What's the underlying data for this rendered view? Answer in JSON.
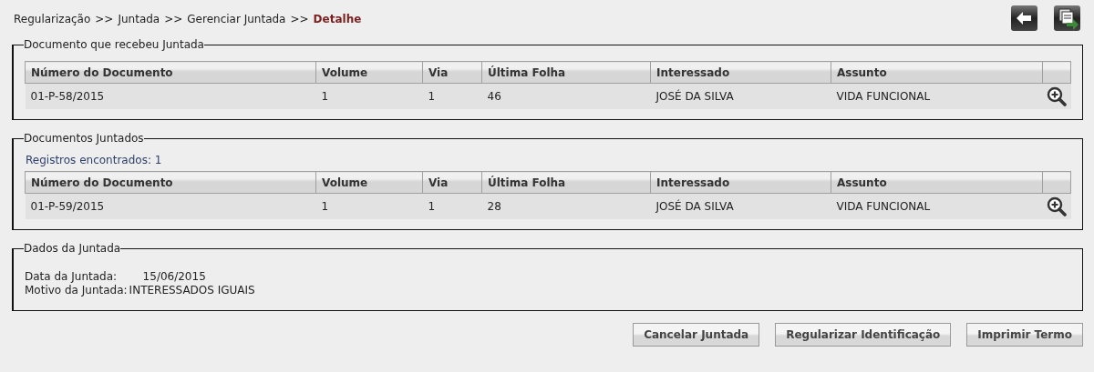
{
  "breadcrumb": [
    {
      "label": "Regularização",
      "kind": "link"
    },
    {
      "label": ">>",
      "kind": "separator"
    },
    {
      "label": "Juntada",
      "kind": "link"
    },
    {
      "label": ">>",
      "kind": "separator"
    },
    {
      "label": "Gerenciar Juntada",
      "kind": "link"
    },
    {
      "label": ">>",
      "kind": "separator"
    },
    {
      "label": "Detalhe",
      "kind": "current"
    }
  ],
  "panels": [
    {
      "kind": "table",
      "legend": "Documento que recebeu Juntada",
      "table": {
        "columns": [
          "Número do Documento",
          "Volume",
          "Via",
          "Última Folha",
          "Interessado",
          "Assunto"
        ],
        "rows": [
          {
            "cells": [
              "01-P-58/2015",
              "1",
              "1",
              "46",
              "JOSÉ DA SILVA",
              "VIDA FUNCIONAL"
            ]
          }
        ]
      }
    },
    {
      "kind": "table",
      "legend": "Documentos Juntados",
      "count": "Registros encontrados: 1",
      "table": {
        "columns": [
          "Número do Documento",
          "Volume",
          "Via",
          "Última Folha",
          "Interessado",
          "Assunto"
        ],
        "rows": [
          {
            "cells": [
              "01-P-59/2015",
              "1",
              "1",
              "28",
              "JOSÉ DA SILVA",
              "VIDA FUNCIONAL"
            ]
          }
        ]
      }
    },
    {
      "kind": "fields",
      "legend": "Dados da Juntada",
      "fields": [
        {
          "label": "Data da Juntada:",
          "value": "15/06/2015"
        },
        {
          "label": "Motivo da Juntada:",
          "value": "INTERESSADOS IGUAIS"
        }
      ]
    }
  ],
  "buttons": [
    "Cancelar Juntada",
    "Regularizar Identificação",
    "Imprimir Termo"
  ]
}
